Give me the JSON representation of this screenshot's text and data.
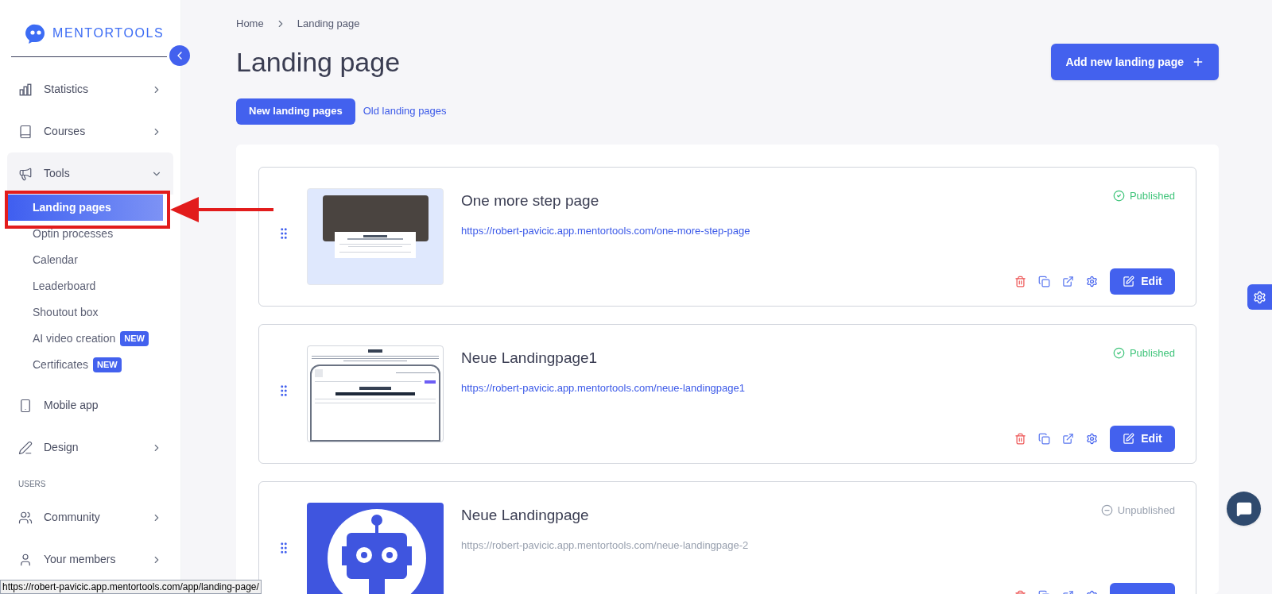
{
  "sidebar": {
    "logo": "MENTORTOOLS",
    "items": [
      {
        "kind": "item",
        "label": "Statistics",
        "expanded": false
      },
      {
        "kind": "item",
        "label": "Courses",
        "expanded": false
      },
      {
        "kind": "item",
        "label": "Tools",
        "expanded": true,
        "children": [
          {
            "label": "Landing pages",
            "selected": true
          },
          {
            "label": "Optin processes",
            "selected": false
          },
          {
            "label": "Calendar",
            "selected": false
          },
          {
            "label": "Leaderboard",
            "selected": false
          },
          {
            "label": "Shoutout box",
            "selected": false
          },
          {
            "label": "AI video creation",
            "selected": false,
            "badge": "NEW"
          },
          {
            "label": "Certificates",
            "selected": false,
            "badge": "NEW"
          }
        ]
      },
      {
        "kind": "item",
        "label": "Mobile app"
      },
      {
        "kind": "item",
        "label": "Design",
        "expanded": false
      },
      {
        "kind": "section",
        "label": "USERS"
      },
      {
        "kind": "item",
        "label": "Community",
        "expanded": false
      },
      {
        "kind": "item",
        "label": "Your members",
        "expanded": false
      }
    ]
  },
  "breadcrumb": [
    "Home",
    "Landing page"
  ],
  "title": "Landing page",
  "add_button": "Add new landing page",
  "tabs": [
    {
      "label": "New landing pages",
      "selected": true
    },
    {
      "label": "Old landing pages",
      "selected": false
    }
  ],
  "pages": [
    {
      "title": "One more step page",
      "url": "https://robert-pavicic.app.mentortools.com/one-more-step-page",
      "status": "Published",
      "published": true,
      "thumbnail": {
        "kind": "confirm"
      },
      "edit": "Edit"
    },
    {
      "title": "Neue Landingpage1",
      "url": "https://robert-pavicic.app.mentortools.com/neue-landingpage1",
      "status": "Published",
      "published": true,
      "thumbnail": {
        "kind": "form"
      },
      "edit": "Edit"
    },
    {
      "title": "Neue Landingpage",
      "url": "https://robert-pavicic.app.mentortools.com/neue-landingpage-2",
      "status": "Unpublished",
      "published": false,
      "thumbnail": {
        "kind": "robot"
      }
    }
  ],
  "status_bar": "https://robert-pavicic.app.mentortools.com/app/landing-page/"
}
